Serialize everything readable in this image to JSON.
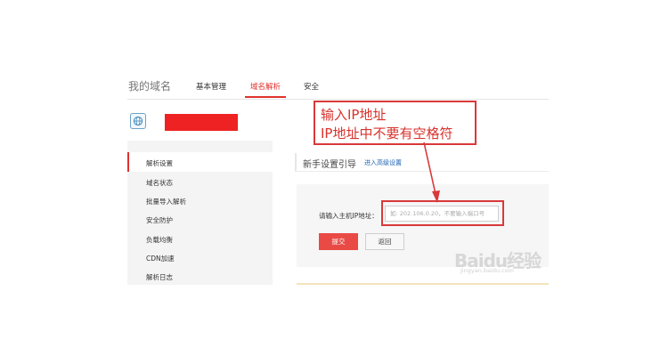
{
  "nav": {
    "title": "我的域名",
    "tabs": [
      {
        "label": "基本管理",
        "active": false
      },
      {
        "label": "域名解析",
        "active": true
      },
      {
        "label": "安全",
        "active": false
      }
    ]
  },
  "domain": {
    "icon": "globe-icon",
    "name_redacted": true
  },
  "sidebar": {
    "items": [
      {
        "label": "解析设置",
        "active": true
      },
      {
        "label": "域名状态"
      },
      {
        "label": "批量导入解析"
      },
      {
        "label": "安全防护"
      },
      {
        "label": "负载均衡"
      },
      {
        "label": "CDN加速"
      },
      {
        "label": "解析日志"
      }
    ]
  },
  "guide": {
    "title": "新手设置引导",
    "advanced_link": "进入高级设置"
  },
  "form": {
    "ip_label": "请输入主机IP地址：",
    "ip_placeholder": "如: 202.106.0.20，不要输入端口号",
    "submit_label": "提交",
    "back_label": "返回"
  },
  "annotation": {
    "line1": "输入IP地址",
    "line2": "IP地址中不要有空格符"
  },
  "watermark": {
    "logo": "Baidu经验",
    "url": "jingyan.baidu.com"
  },
  "colors": {
    "accent": "#e0312d",
    "annotation": "#d9383a",
    "link": "#1a62b3"
  }
}
